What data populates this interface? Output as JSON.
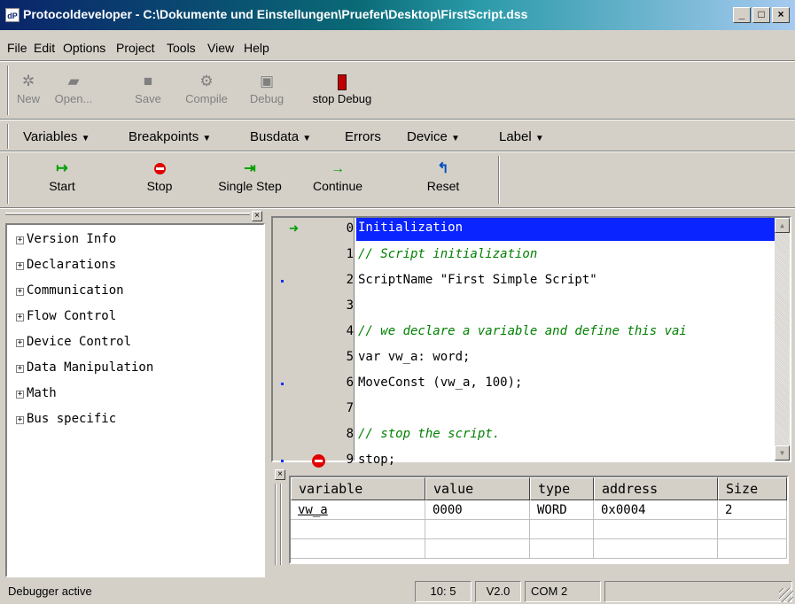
{
  "window": {
    "title": "Protocoldeveloper - C:\\Dokumente und Einstellungen\\Pruefer\\Desktop\\FirstScript.dss",
    "app_icon": "dP",
    "controls": {
      "minimize": "_",
      "maximize": "□",
      "close": "×"
    }
  },
  "menu": [
    "File",
    "Edit",
    "Options",
    "Project",
    "Tools",
    "View",
    "Help"
  ],
  "toolbar": {
    "buttons": [
      {
        "label": "New",
        "icon": "new-icon",
        "enabled": false
      },
      {
        "label": "Open...",
        "icon": "open-icon",
        "enabled": false
      },
      {
        "label": "Save",
        "icon": "save-icon",
        "enabled": false
      },
      {
        "label": "Compile",
        "icon": "compile-icon",
        "enabled": false
      },
      {
        "label": "Debug",
        "icon": "debug-icon",
        "enabled": false
      },
      {
        "label": "stop Debug",
        "icon": "stop-debug-icon",
        "enabled": true
      }
    ]
  },
  "dropdown_menu": [
    "Variables",
    "Breakpoints",
    "Busdata",
    "Errors",
    "Device",
    "Label"
  ],
  "debug_toolbar": [
    {
      "label": "Start",
      "icon": "start-arrow-icon"
    },
    {
      "label": "Stop",
      "icon": "stop-icon"
    },
    {
      "label": "Single Step",
      "icon": "single-step-icon"
    },
    {
      "label": "Continue",
      "icon": "continue-icon"
    },
    {
      "label": "Reset",
      "icon": "reset-icon"
    }
  ],
  "tree": [
    "Version Info",
    "Declarations",
    "Communication",
    "Flow Control",
    "Device Control",
    "Data Manipulation",
    "Math",
    "Bus specific"
  ],
  "editor": {
    "lines": [
      {
        "num": "0",
        "code": "Initialization",
        "comment": false,
        "highlight": true,
        "marker": "arrow"
      },
      {
        "num": "1",
        "code": "// Script initialization",
        "comment": true,
        "highlight": false,
        "marker": ""
      },
      {
        "num": "2",
        "code": "ScriptName \"First Simple Script\"",
        "comment": false,
        "highlight": false,
        "marker": "dot"
      },
      {
        "num": "3",
        "code": "",
        "comment": false,
        "highlight": false,
        "marker": ""
      },
      {
        "num": "4",
        "code": "// we declare a variable and define this vai",
        "comment": true,
        "highlight": false,
        "marker": ""
      },
      {
        "num": "5",
        "code": "var vw_a: word;",
        "comment": false,
        "highlight": false,
        "marker": ""
      },
      {
        "num": "6",
        "code": "MoveConst (vw_a, 100);",
        "comment": false,
        "highlight": false,
        "marker": "dot"
      },
      {
        "num": "7",
        "code": "",
        "comment": false,
        "highlight": false,
        "marker": ""
      },
      {
        "num": "8",
        "code": "// stop the script.",
        "comment": true,
        "highlight": false,
        "marker": ""
      },
      {
        "num": "9",
        "code": "stop;",
        "comment": false,
        "highlight": false,
        "marker": "dot-stop"
      }
    ]
  },
  "variables_table": {
    "headers": [
      "variable",
      "value",
      "type",
      "address",
      "Size"
    ],
    "rows": [
      [
        "vw_a",
        "0000",
        "WORD",
        "0x0004",
        "2"
      ]
    ]
  },
  "status": {
    "message": "Debugger active",
    "position": "10: 5",
    "version": "V2.0",
    "port": "COM 2"
  },
  "colors": {
    "highlight": "#0a24ff",
    "comment": "#008000",
    "arrow": "#00a000",
    "stop": "#e00000"
  }
}
